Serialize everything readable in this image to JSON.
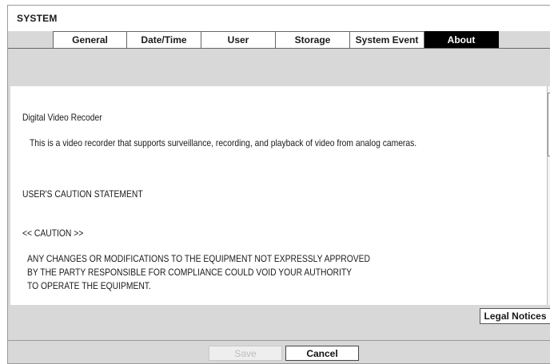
{
  "window": {
    "title": "SYSTEM"
  },
  "tabs": [
    {
      "label": "General",
      "active": false
    },
    {
      "label": "Date/Time",
      "active": false
    },
    {
      "label": "User",
      "active": false
    },
    {
      "label": "Storage",
      "active": false
    },
    {
      "label": "System Event",
      "active": false
    },
    {
      "label": "About",
      "active": true
    }
  ],
  "about": {
    "product_name": "Digital Video Recoder",
    "description": "This is a video recorder that supports surveillance, recording, and playback of video from analog cameras.",
    "caution_heading": "USER'S CAUTION STATEMENT",
    "caution_label": "<< CAUTION >>",
    "caution_lines": [
      "ANY CHANGES OR MODIFICATIONS TO THE EQUIPMENT NOT EXPRESSLY APPROVED",
      "BY THE PARTY RESPONSIBLE FOR COMPLIANCE COULD VOID YOUR AUTHORITY",
      "TO OPERATE THE EQUIPMENT."
    ]
  },
  "buttons": {
    "legal_notices": "Legal Notices",
    "save": "Save",
    "cancel": "Cancel"
  },
  "colors": {
    "active_tab_bg": "#000000",
    "panel_bg": "#d8d8d8",
    "disabled_text": "#bdbdbd"
  }
}
